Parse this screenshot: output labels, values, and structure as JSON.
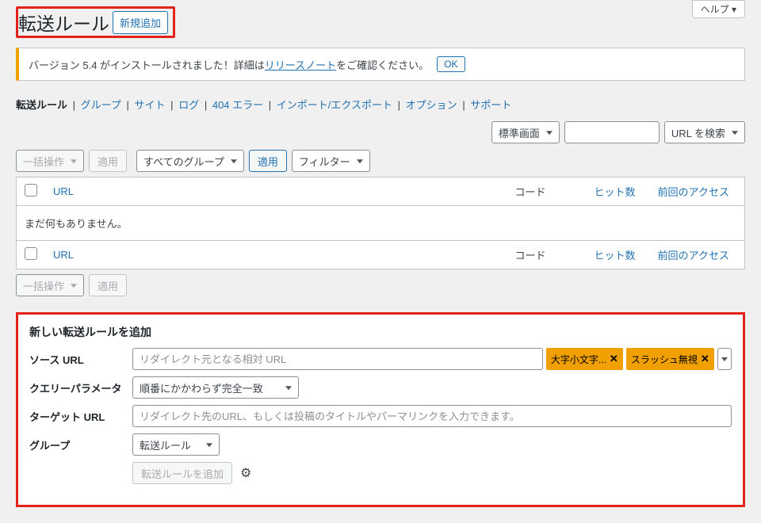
{
  "header": {
    "title_prefix": "転送ルール",
    "new_button": "新規追加",
    "help": "ヘルプ"
  },
  "notice": {
    "text_before": "バージョン 5.4 がインストールされました！詳細は",
    "link": "リリースノート",
    "text_after": "をご確認ください。",
    "ok": "OK"
  },
  "subnav": {
    "items": [
      "転送ルール",
      "グループ",
      "サイト",
      "ログ",
      "404 エラー",
      "インポート/エクスポート",
      "オプション",
      "サポート"
    ]
  },
  "toolbar": {
    "display_mode": "標準画面",
    "search_button": "URL を検索"
  },
  "filters": {
    "bulk_action": "一括操作",
    "apply": "適用",
    "all_groups": "すべてのグループ",
    "apply2": "適用",
    "filter": "フィルター"
  },
  "table": {
    "headers": {
      "url": "URL",
      "code": "コード",
      "hits": "ヒット数",
      "last": "前回のアクセス"
    },
    "no_items": "まだ何もありません。"
  },
  "bottom": {
    "bulk_action": "一括操作",
    "apply": "適用"
  },
  "form": {
    "title": "新しい転送ルールを追加",
    "labels": {
      "source_url": "ソース URL",
      "query": "クエリーパラメータ",
      "target_url": "ターゲット URL",
      "group": "グループ"
    },
    "placeholders": {
      "source_url": "リダイレクト元となる相対 URL",
      "target_url": "リダイレクト先のURL、もしくは投稿のタイトルやパーマリンクを入力できます。"
    },
    "query_value": "順番にかかわらず完全一致",
    "group_value": "転送ルール",
    "chips": {
      "case": "大字小文字...",
      "slash": "スラッシュ無視"
    },
    "submit": "転送ルールを追加"
  }
}
